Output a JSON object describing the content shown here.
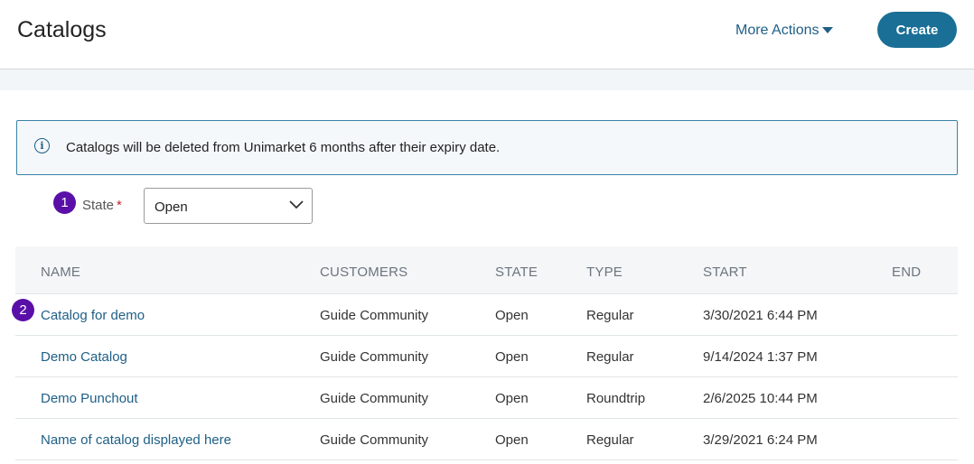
{
  "header": {
    "title": "Catalogs",
    "more_actions_label": "More Actions",
    "create_label": "Create"
  },
  "info": {
    "icon": "info-icon",
    "message": "Catalogs will be deleted from Unimarket 6 months after their expiry date."
  },
  "steps": {
    "one": "1",
    "two": "2"
  },
  "filter": {
    "label": "State",
    "required_mark": "*",
    "selected": "Open"
  },
  "table": {
    "columns": [
      "NAME",
      "CUSTOMERS",
      "STATE",
      "TYPE",
      "START",
      "END"
    ],
    "rows": [
      {
        "name": "Catalog for demo",
        "customers": "Guide Community",
        "state": "Open",
        "type": "Regular",
        "start": "3/30/2021 6:44 PM",
        "end": ""
      },
      {
        "name": "Demo Catalog",
        "customers": "Guide Community",
        "state": "Open",
        "type": "Regular",
        "start": "9/14/2024 1:37 PM",
        "end": ""
      },
      {
        "name": "Demo Punchout",
        "customers": "Guide Community",
        "state": "Open",
        "type": "Roundtrip",
        "start": "2/6/2025 10:44 PM",
        "end": ""
      },
      {
        "name": "Name of catalog displayed here",
        "customers": "Guide Community",
        "state": "Open",
        "type": "Regular",
        "start": "3/29/2021 6:24 PM",
        "end": ""
      }
    ]
  },
  "colors": {
    "accent": "#1a6f96",
    "link": "#1e5f86",
    "step_badge": "#5a0fa8",
    "required": "#c4262e"
  }
}
